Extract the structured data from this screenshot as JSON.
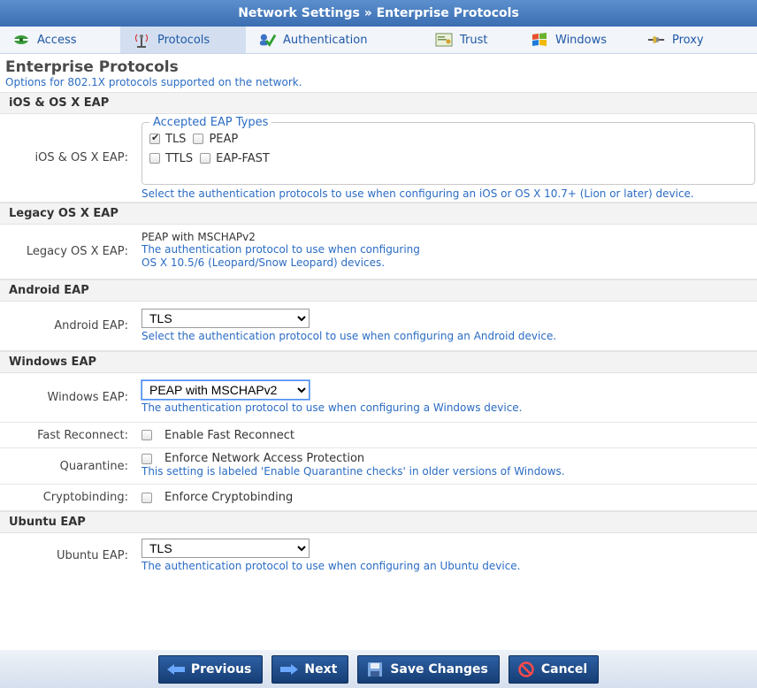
{
  "window": {
    "title": "Network Settings » Enterprise Protocols"
  },
  "tabs": [
    {
      "label": "Access",
      "icon": "access-icon"
    },
    {
      "label": "Protocols",
      "icon": "protocols-icon",
      "active": true
    },
    {
      "label": "Authentication",
      "icon": "authentication-icon"
    },
    {
      "label": "Trust",
      "icon": "trust-icon"
    },
    {
      "label": "Windows",
      "icon": "windows-icon"
    },
    {
      "label": "Proxy",
      "icon": "proxy-icon"
    }
  ],
  "page": {
    "title": "Enterprise Protocols",
    "subtitle": "Options for 802.1X protocols supported on the network."
  },
  "ios": {
    "section": "iOS & OS X EAP",
    "label": "iOS & OS X EAP:",
    "legend": "Accepted EAP Types",
    "options": [
      {
        "label": "TLS",
        "checked": true
      },
      {
        "label": "PEAP",
        "checked": false
      },
      {
        "label": "TTLS",
        "checked": false
      },
      {
        "label": "EAP-FAST",
        "checked": false
      }
    ],
    "hint": "Select the authentication protocols to use when configuring an iOS or OS X 10.7+ (Lion or later) device."
  },
  "legacy": {
    "section": "Legacy OS X EAP",
    "label": "Legacy OS X EAP:",
    "value": "PEAP with MSCHAPv2",
    "hint1": "The authentication protocol to use when configuring",
    "hint2": "OS X 10.5/6 (Leopard/Snow Leopard) devices."
  },
  "android": {
    "section": "Android EAP",
    "label": "Android EAP:",
    "value": "TLS",
    "hint": "Select the authentication protocol to use when configuring an Android device."
  },
  "windows": {
    "section": "Windows EAP",
    "label": "Windows EAP:",
    "value": "PEAP with MSCHAPv2",
    "hint": "The authentication protocol to use when configuring a Windows device.",
    "fast_label": "Fast Reconnect:",
    "fast_text": "Enable Fast Reconnect",
    "quarantine_label": "Quarantine:",
    "quarantine_text": "Enforce Network Access Protection",
    "quarantine_hint": "This setting is labeled 'Enable Quarantine checks' in older versions of Windows.",
    "crypto_label": "Cryptobinding:",
    "crypto_text": "Enforce Cryptobinding"
  },
  "ubuntu": {
    "section": "Ubuntu EAP",
    "label": "Ubuntu EAP:",
    "value": "TLS",
    "hint": "The authentication protocol to use when configuring an Ubuntu device."
  },
  "footer": {
    "previous": "Previous",
    "next": "Next",
    "save": "Save Changes",
    "cancel": "Cancel"
  }
}
